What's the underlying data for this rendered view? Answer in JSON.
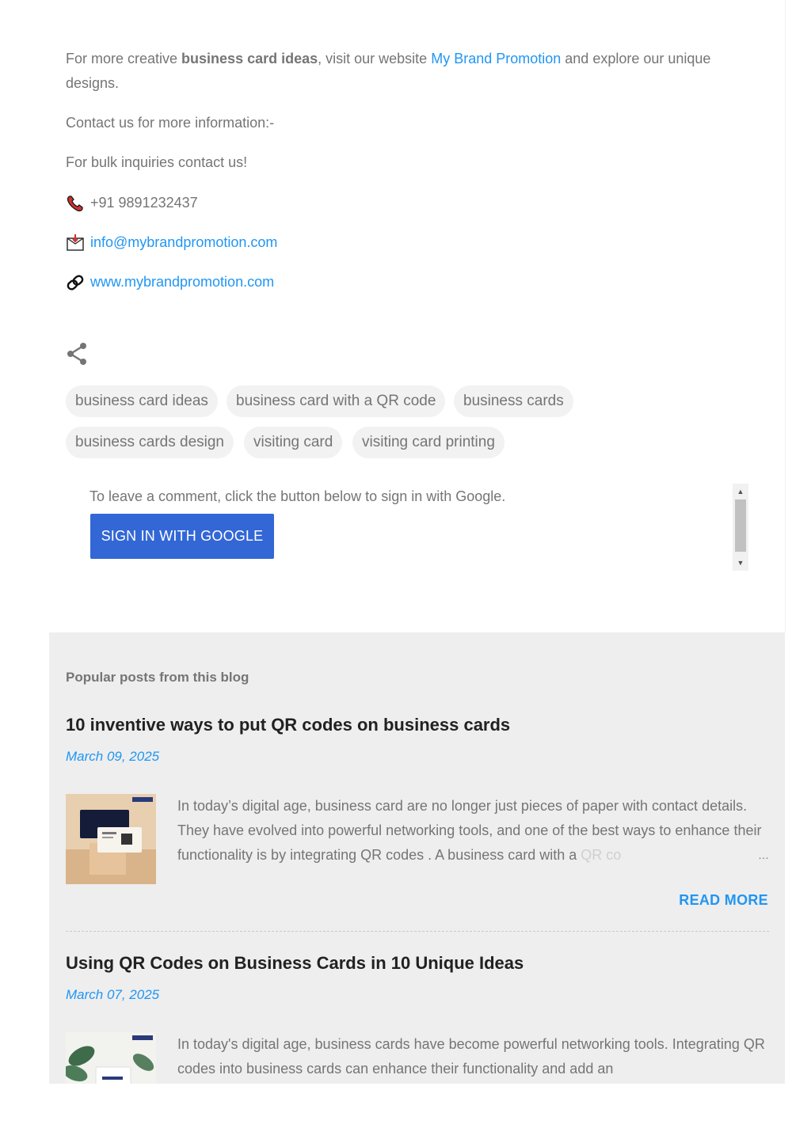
{
  "post": {
    "intro": {
      "prefix": "For more creative ",
      "bold": "business card ideas",
      "middle": ", visit our website ",
      "link": "My Brand Promotion",
      "suffix": " and explore our unique designs."
    },
    "contact_heading": "Contact us for more information:-",
    "bulk_text": "For bulk inquiries contact us!",
    "phone": "+91 9891232437",
    "email": "info@mybrandpromotion.com",
    "website": "www.mybrandpromotion.com",
    "icons": {
      "phone": "telephone-receiver-icon",
      "email": "envelope-icon",
      "website": "link-icon",
      "share": "share-icon"
    }
  },
  "labels": [
    "business card ideas",
    "business card with a QR code",
    "business cards",
    "business cards design",
    "visiting card",
    "visiting card printing"
  ],
  "comments": {
    "prompt": "To leave a comment, click the button below to sign in with Google.",
    "signin_label": "SIGN IN WITH GOOGLE"
  },
  "popular": {
    "heading": "Popular posts from this blog",
    "posts": [
      {
        "title": "10 inventive ways to put QR codes on business cards",
        "date": "March 09, 2025",
        "snippet_main": "In today’s digital age, business card are no longer just pieces of paper with contact details. They have evolved into powerful networking tools, and one of the best ways to enhance their functionality is by integrating QR codes . A business card with a ",
        "snippet_fade": "QR co",
        "ellipsis": "…",
        "read_more": "READ MORE"
      },
      {
        "title": "Using QR Codes on Business Cards in 10 Unique Ideas",
        "date": "March 07, 2025",
        "snippet_main": " In today's digital age, business cards have become powerful networking tools. Integrating QR codes into business cards can enhance their functionality and add an"
      }
    ]
  },
  "colors": {
    "link": "#2196f3",
    "button": "#3367d6",
    "section_bg": "#eeeeee",
    "text": "#757575",
    "title": "#212121"
  }
}
